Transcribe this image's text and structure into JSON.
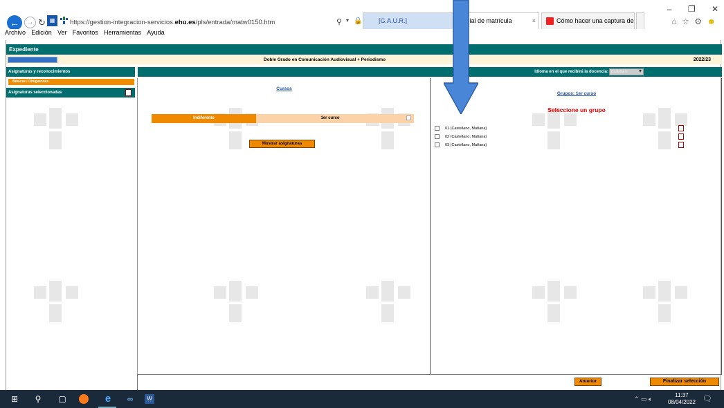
{
  "browser": {
    "url_prefix": "https://gestion-integracion-servicios.",
    "url_domain": "ehu.es",
    "url_path": "/pls/entrada/matw0150.htm",
    "tabs": [
      {
        "label": "[G.A.U.R.]"
      },
      {
        "label": "encial de matrícula",
        "close": "×"
      },
      {
        "label": "Cómo hacer una captura de pa..."
      }
    ],
    "menu": [
      "Archivo",
      "Edición",
      "Ver",
      "Favoritos",
      "Herramientas",
      "Ayuda"
    ],
    "window_controls": {
      "minimize": "–",
      "restore": "❐",
      "close": "✕"
    }
  },
  "page": {
    "expediente": "Expediente",
    "degree": "Doble Grado en Comunicación Audiovisual + Periodismo",
    "year": "2022/23",
    "sidebar": {
      "asignaturas": "Asignaturas y reconocimientos",
      "basicas": "Básicas / Obligatorias",
      "seleccionadas": "Asignaturas seleccionadas"
    },
    "idioma_label": "Idioma en el que recibirá la docencia:",
    "idioma_value": "Castellano",
    "cursos_title": "Cursos",
    "indiferente": "Indiferente",
    "primer_curso": "1er curso",
    "mostrar_button": "Mostrar asignaturas",
    "grupos_title": "Grupos:   1er curso",
    "seleccione": "Seleccione un grupo",
    "groups": [
      {
        "label": "01 (Castellano, Mañana)"
      },
      {
        "label": "02 (Castellano, Mañana)"
      },
      {
        "label": "03 (Castellano, Mañana)"
      }
    ],
    "anterior_button": "Anterior",
    "finalizar_button": "Finalizar selección"
  },
  "taskbar": {
    "time": "11:37",
    "date": "08/04/2022"
  },
  "colors": {
    "teal": "#006d6f",
    "orange": "#ef8a00",
    "light_orange": "#fcd2a8",
    "link_blue": "#1a4f9c",
    "alert_red": "#e00000",
    "arrow_blue": "#4a86d8"
  },
  "icons": [
    "back-arrow-icon",
    "forward-arrow-icon",
    "reload-icon",
    "search-icon",
    "lock-icon",
    "home-icon",
    "star-icon",
    "gear-icon",
    "smiley-icon",
    "windows-start-icon",
    "firefox-icon",
    "internet-explorer-icon",
    "word-icon"
  ]
}
